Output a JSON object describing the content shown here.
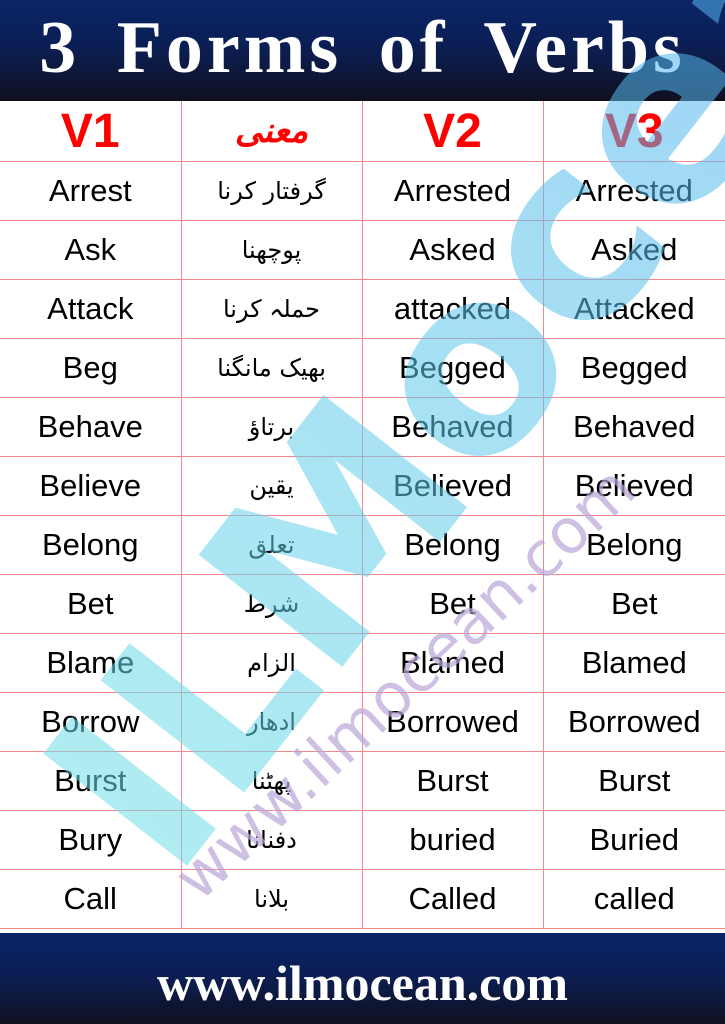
{
  "header": {
    "title": "3 Forms of Verbs"
  },
  "columns": {
    "v1": "V1",
    "meaning": "معنی",
    "v2": "V2",
    "v3": "V3"
  },
  "watermark": {
    "logo": "ILMocean",
    "url": "www.ilmocean.com"
  },
  "colors": {
    "banner": "#0b1f55",
    "heading": "#ff0000",
    "grid": "#f5888c",
    "text": "#000000"
  },
  "rows": [
    {
      "v1": "Arrest",
      "meaning": "گرفتار کرنا",
      "v2": "Arrested",
      "v3": "Arrested"
    },
    {
      "v1": "Ask",
      "meaning": "پوچھنا",
      "v2": "Asked",
      "v3": "Asked"
    },
    {
      "v1": "Attack",
      "meaning": "حملہ کرنا",
      "v2": "attacked",
      "v3": "Attacked"
    },
    {
      "v1": "Beg",
      "meaning": "بھیک مانگنا",
      "v2": "Begged",
      "v3": "Begged"
    },
    {
      "v1": "Behave",
      "meaning": "برتاؤ",
      "v2": "Behaved",
      "v3": "Behaved"
    },
    {
      "v1": "Believe",
      "meaning": "یقین",
      "v2": "Believed",
      "v3": "Believed"
    },
    {
      "v1": "Belong",
      "meaning": "تعلق",
      "v2": "Belong",
      "v3": "Belong"
    },
    {
      "v1": "Bet",
      "meaning": "شرط",
      "v2": "Bet",
      "v3": "Bet"
    },
    {
      "v1": "Blame",
      "meaning": "الزام",
      "v2": "Blamed",
      "v3": "Blamed"
    },
    {
      "v1": "Borrow",
      "meaning": "ادھار",
      "v2": "Borrowed",
      "v3": "Borrowed"
    },
    {
      "v1": "Burst",
      "meaning": "پھٹنا",
      "v2": "Burst",
      "v3": "Burst"
    },
    {
      "v1": "Bury",
      "meaning": "دفنانا",
      "v2": "buried",
      "v3": "Buried"
    },
    {
      "v1": "Call",
      "meaning": "بلانا",
      "v2": "Called",
      "v3": "called"
    }
  ],
  "footer": {
    "website": "www.ilmocean.com"
  }
}
